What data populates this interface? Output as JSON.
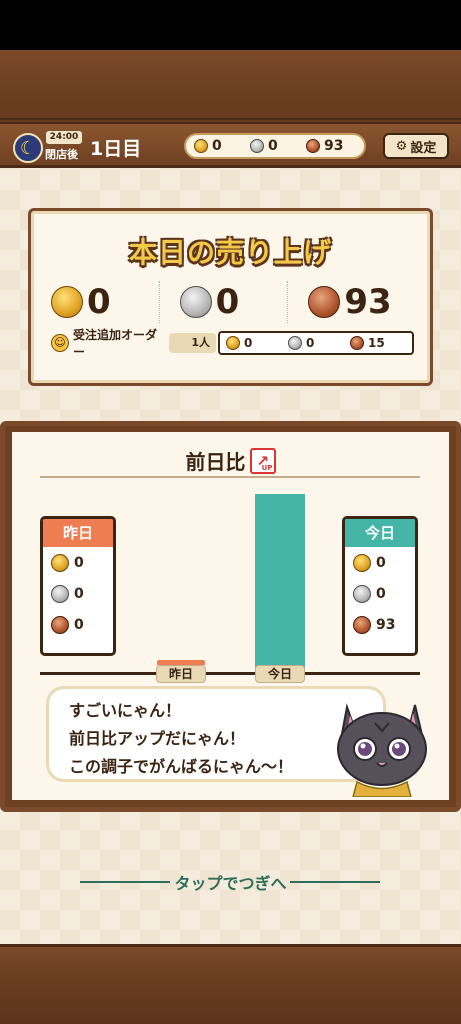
{
  "hud": {
    "time": "24:00",
    "status": "閉店後",
    "day": "1日目",
    "coins": {
      "gold": "0",
      "silver": "0",
      "bronze": "93"
    },
    "settings_label": "設定"
  },
  "sales": {
    "title": "本日の売り上げ",
    "gold": "0",
    "silver": "0",
    "bronze": "93",
    "extra_label": "受注追加オーダー",
    "extra_count": "1人",
    "extra": {
      "gold": "0",
      "silver": "0",
      "bronze": "15"
    }
  },
  "compare": {
    "title": "前日比",
    "badge": "UP",
    "yesterday": {
      "label": "昨日",
      "gold": "0",
      "silver": "0",
      "bronze": "0"
    },
    "today": {
      "label": "今日",
      "gold": "0",
      "silver": "0",
      "bronze": "93"
    },
    "xlabels": [
      "昨日",
      "今日"
    ],
    "message": [
      "すごいにゃん！",
      "前日比アップだにゃん！",
      "この調子でがんばるにゃん〜！"
    ]
  },
  "chart_data": {
    "type": "bar",
    "categories": [
      "昨日",
      "今日"
    ],
    "values": [
      0,
      93
    ]
  },
  "tap_label": "タップでつぎへ",
  "colors": {
    "wood": "#6e4022",
    "yesterday": "#ef7d52",
    "today": "#45b5a8",
    "text": "#3b2412"
  },
  "icons": [
    "moon-icon",
    "gold-coin-icon",
    "silver-coin-icon",
    "bronze-coin-icon",
    "gear-icon",
    "smile-icon",
    "up-arrow-icon",
    "cat-mascot"
  ]
}
